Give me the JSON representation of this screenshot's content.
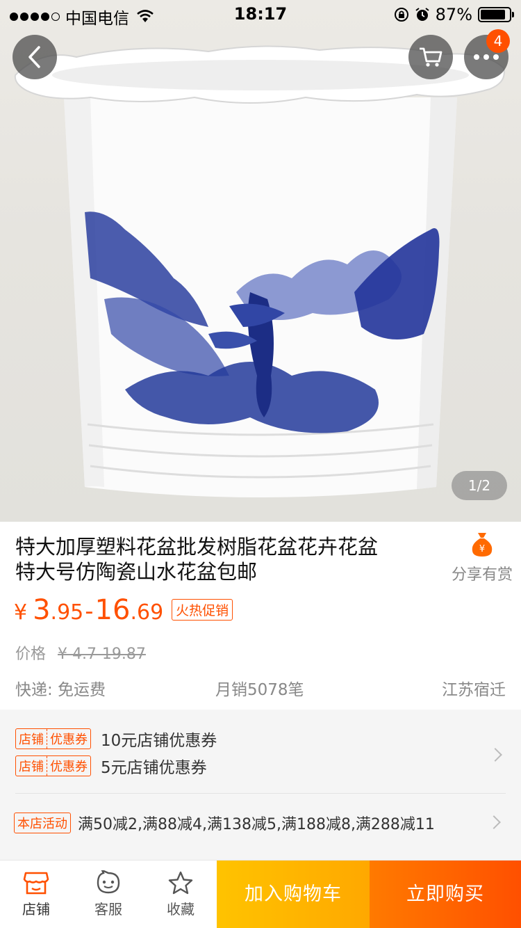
{
  "status_bar": {
    "carrier": "中国电信",
    "time": "18:17",
    "battery": "87%",
    "battery_level": 0.87,
    "signal_bars": 4
  },
  "nav": {
    "back_icon": "chevron-left-icon",
    "cart_icon": "shopping-cart-icon",
    "more_icon": "more-dots-icon",
    "badge_count": "4"
  },
  "gallery": {
    "pager": "1/2",
    "image": "blue-white landscape flower pot"
  },
  "product": {
    "title_line1": "特大加厚塑料花盆批发树脂花盆花卉花盆",
    "title_line2": "特大号仿陶瓷山水花盆包邮",
    "share_label": "分享有赏",
    "share_icon": "money-bag-icon",
    "price_symbol": "¥",
    "price_low_int": "3",
    "price_low_dec": ".95",
    "price_dash": "-",
    "price_high_int": "16",
    "price_high_dec": ".69",
    "promo_tag": "火热促销",
    "orig_label": "价格",
    "orig_price": "¥ 4.7-19.87",
    "shipping": "快递: 免运费",
    "monthly_sales": "月销5078笔",
    "location": "江苏宿迁"
  },
  "coupons": {
    "tag_part1": "店铺",
    "tag_part2": "优惠券",
    "items": [
      {
        "text": "10元店铺优惠券"
      },
      {
        "text": "5元店铺优惠券"
      }
    ],
    "activity_tag": "本店活动",
    "activity_text": "满50减2,满88减4,满138减5,满188减8,满288减11"
  },
  "bottom_bar": {
    "store_label": "店铺",
    "service_label": "客服",
    "favorite_label": "收藏",
    "add_to_cart": "加入购物车",
    "buy_now": "立即购买"
  },
  "colors": {
    "accent": "#ff5000",
    "cart_button": "#ffb400",
    "buy_button": "#ff5f00",
    "porcelain_blue": "#23399a"
  }
}
